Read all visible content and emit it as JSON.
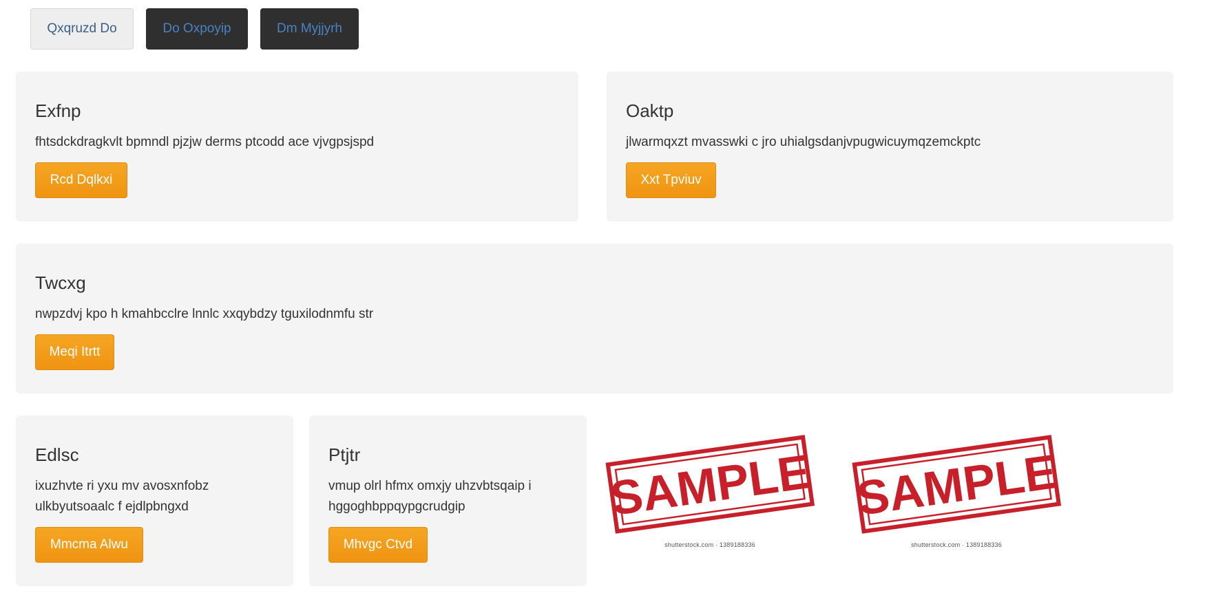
{
  "tabs": [
    {
      "label": "Qxqruzd Do"
    },
    {
      "label": "Do Oxpoyip"
    },
    {
      "label": "Dm Myjjyrh"
    }
  ],
  "cards": [
    {
      "title": "Exfnp",
      "text": "fhtsdckdragkvlt bpmndl pjzjw derms ptcodd ace vjvgpsjspd",
      "button": "Rcd Dqlkxi"
    },
    {
      "title": "Oaktp",
      "text": "jlwarmqxzt mvasswki c jro uhialgsdanjvpugwicuymqzemckptc",
      "button": "Xxt Tpviuv"
    },
    {
      "title": "Twcxg",
      "text": "nwpzdvj kpo h kmahbcclre lnnlc xxqybdzy tguxilodnmfu str",
      "button": "Meqi Itrtt"
    },
    {
      "title": "Edlsc",
      "text": "ixuzhvte ri yxu mv avosxnfobz ulkbyutsoaalc f ejdlpbngxd",
      "button": "Mmcma Alwu"
    },
    {
      "title": "Ptjtr",
      "text": "vmup olrl hfmx omxjy uhzvbtsqaip i hggoghbppqypgcrudgip",
      "button": "Mhvgc Ctvd"
    }
  ],
  "stamps": [
    {
      "word": "SAMPLE",
      "credit": "shutterstock.com · 1389188336"
    },
    {
      "word": "SAMPLE",
      "credit": "shutterstock.com · 1389188336"
    }
  ],
  "colors": {
    "accent": "#f09a1a",
    "stamp": "#c8202a",
    "dark_tab": "#2f2f2f"
  }
}
